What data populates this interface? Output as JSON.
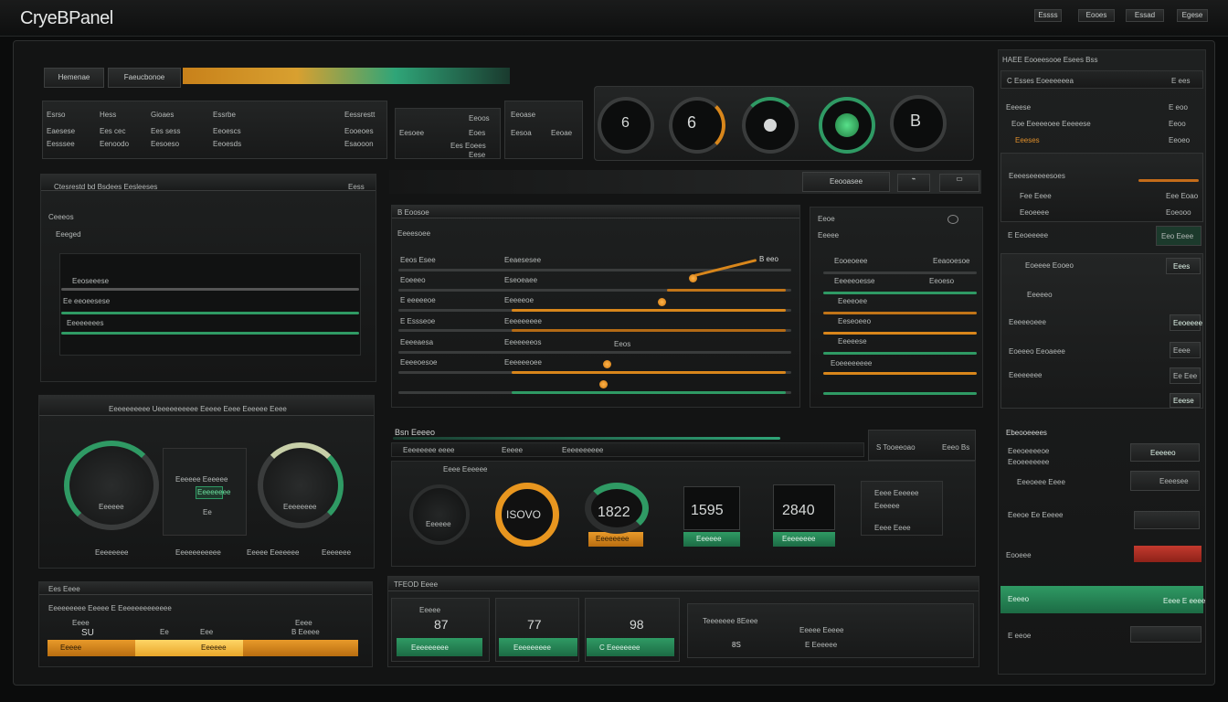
{
  "app": {
    "title": "CryeBPanel"
  },
  "top_buttons": [
    "Essss",
    "Eooes",
    "Essad",
    "Egese"
  ],
  "colors": {
    "accent_green": "#2f9a64",
    "accent_orange": "#e89a2a",
    "alert_red": "#c33a2e",
    "background": "#0b0c0c"
  },
  "tabs": {
    "left": "Hemenae",
    "right": "Faeucbonoe"
  },
  "stat_table": {
    "rows": [
      [
        "Esrso",
        "Hess",
        "Gioaes",
        "Essrbe",
        "Eessrestt"
      ],
      [
        "Eaesese",
        "Ees cec",
        "Ees sess",
        "Eeoescs",
        "Eooeoes"
      ],
      [
        "Eesssee",
        "Eenoodo",
        "Eesoeso",
        "Eeoesds",
        "Esaooon"
      ]
    ],
    "right": [
      [
        "Eesoee",
        "Eeoos"
      ],
      [
        "Ees Eoees",
        "Eoes"
      ],
      [
        "",
        "Eese"
      ]
    ],
    "small": [
      [
        "Eeoase",
        "Eeoae"
      ],
      [
        "Eesoa",
        "Eese"
      ],
      [
        "Eoons",
        "Eoos"
      ]
    ]
  },
  "gauges_top": [
    "6",
    "6",
    "",
    "",
    "B"
  ],
  "filter_panel": {
    "title": "Ctesrestd bd Bsdees Eesleeses",
    "count": "Eess",
    "section": "Ceeeos",
    "sub": "Eeeged",
    "chart_labels": [
      "Eeoseeese",
      "Ee eeoeesese",
      "Eeeeeeees"
    ]
  },
  "mid_toolbar": {
    "label": "Eeooasee"
  },
  "sliders": {
    "title": "B Eoosoe",
    "sub": "Eeeesoee",
    "badge": "B eeo",
    "left": [
      "Eeos Esee",
      "Eoeeeo",
      "E eeeeeoe",
      "E Essseoe",
      "Eeeeaesa",
      "Eeeeoesoe"
    ],
    "mid": [
      "Eeaesesee",
      "Eseoeaee",
      "Eeeeeoe",
      "Eeeeeeeee",
      "Eeeeeeeos",
      "Eeeeeeoee"
    ],
    "mid_value": "Eeos"
  },
  "sliders_right": {
    "title": "Eeoe",
    "sub": "Eeeee",
    "rows": [
      "Eooeoeee",
      "Eeeeeoesse",
      "Eeeeoee",
      "Eeseoeeo",
      "Eeeeese",
      "Eoeeeeeeee"
    ],
    "values": [
      "Eeaooesoe",
      "Eeoeso",
      "",
      "",
      "",
      ""
    ]
  },
  "sidebar": {
    "title": "HAEE Eooeesooe Esees Bss",
    "header_left": "C Esses Eoeeeeeea",
    "header_right": "E ees",
    "r1": "Eeeese",
    "r1v": "E eoo",
    "r2": "Eoe Eeeeeoee Eeeeese",
    "r2v": "Eeoo",
    "r3": "Eeeses",
    "r3v": "Eeoeo",
    "b1": "Eeeeseeeeesoes",
    "b2l": "Fee Eeee",
    "b2r": "Eee Eoao",
    "b3l": "Eeoeeee",
    "b3r": "Eoeooo",
    "b4": "E Eeoeeeee",
    "b4v": "Eeo Eeee",
    "items": [
      {
        "label": "Eoeeee Eooeo",
        "value": "Eees"
      },
      {
        "label": "Eeeeeo",
        "value": "Eeoeeee"
      },
      {
        "label": "Eeeeeoeee",
        "value": "Eeee"
      },
      {
        "label": "Eoeeeo Eeoaeee",
        "value": "Ee Eee"
      },
      {
        "label": "Eeeeeeee",
        "value": "Eeese"
      }
    ],
    "sec2": "Ebeooeeees",
    "s2a": "Eeeoeeeeoe",
    "s2av": "Eeeeeo",
    "s2b": "Eeoeeeeeee",
    "s2bv": "Eeeesee",
    "s2c": "Eeeoeee Eeee",
    "s2d": "Eeeoe Ee Eeeee",
    "s2e": "Eooeee",
    "s2ev": "Eeeeo",
    "s2f": "Eeee E eeee",
    "s2fv": "E eeoe"
  },
  "dials_panel": {
    "title": "Eeeeeeeeee Ueeeeeeeeee Eeeee Eeee Eeeeee Eeee",
    "center_l1": "Eeeeee Eeeeee",
    "center_l2": "Eeeeeeee",
    "center_l3": "Ee",
    "left_label": "Eeeeee",
    "right_label": "Eeeeeeee",
    "footer": [
      "Eeeeeeee",
      "Eeeeeeeeeee",
      "Eeeee Eeeeeee",
      "Eeeeeee"
    ]
  },
  "readouts": {
    "title": "Bsn Eeeeo",
    "toolbar": [
      "Eeeeeeee eeee",
      "Eeeee",
      "Eeeeeeeeee"
    ],
    "sub": "Eeee Eeeeee",
    "ring1": "",
    "ring1_label": "Eeeeee",
    "ring2": "ISOVO",
    "ring2_label": "Eeeeeeee",
    "ring3": "1822",
    "lcd1": "1595",
    "lcd1_label": "Eeeeee",
    "lcd2": "2840",
    "lcd2_label": "Eeeeeeee",
    "side_title": "S Tooeeoao",
    "side_value": "Eeeo Bs",
    "side_rows": [
      "Eeee Eeeeee",
      "Eeeeee",
      "Eeee Eeee"
    ]
  },
  "progress_panel": {
    "title": "Ees Eeee",
    "sub": "Eeeeeeeee Eeeee E Eeeeeeeeeeeee",
    "cols": [
      "Eeee",
      "Eeee",
      "Eeeeeeee"
    ],
    "vals": [
      "SU",
      "Ee",
      "Eee",
      "Eeeee",
      "B Eeeee"
    ],
    "segments": [
      "Eeeee",
      "Eeeeee"
    ]
  },
  "counters": {
    "title": "TFEOD Eeee",
    "items": [
      {
        "label": "Eeeee",
        "value": "87",
        "button": "Eeeeeeeee"
      },
      {
        "label": "",
        "value": "77",
        "button": "Eeeeeeeee"
      },
      {
        "label": "",
        "value": "98",
        "button": "C Eeeeeeee"
      }
    ],
    "side_l1": "Teeeeeee 8Eeee",
    "side_l2": "Eeeee Eeeee",
    "side_l3": "E Eeeeee",
    "side_val": "8S"
  }
}
